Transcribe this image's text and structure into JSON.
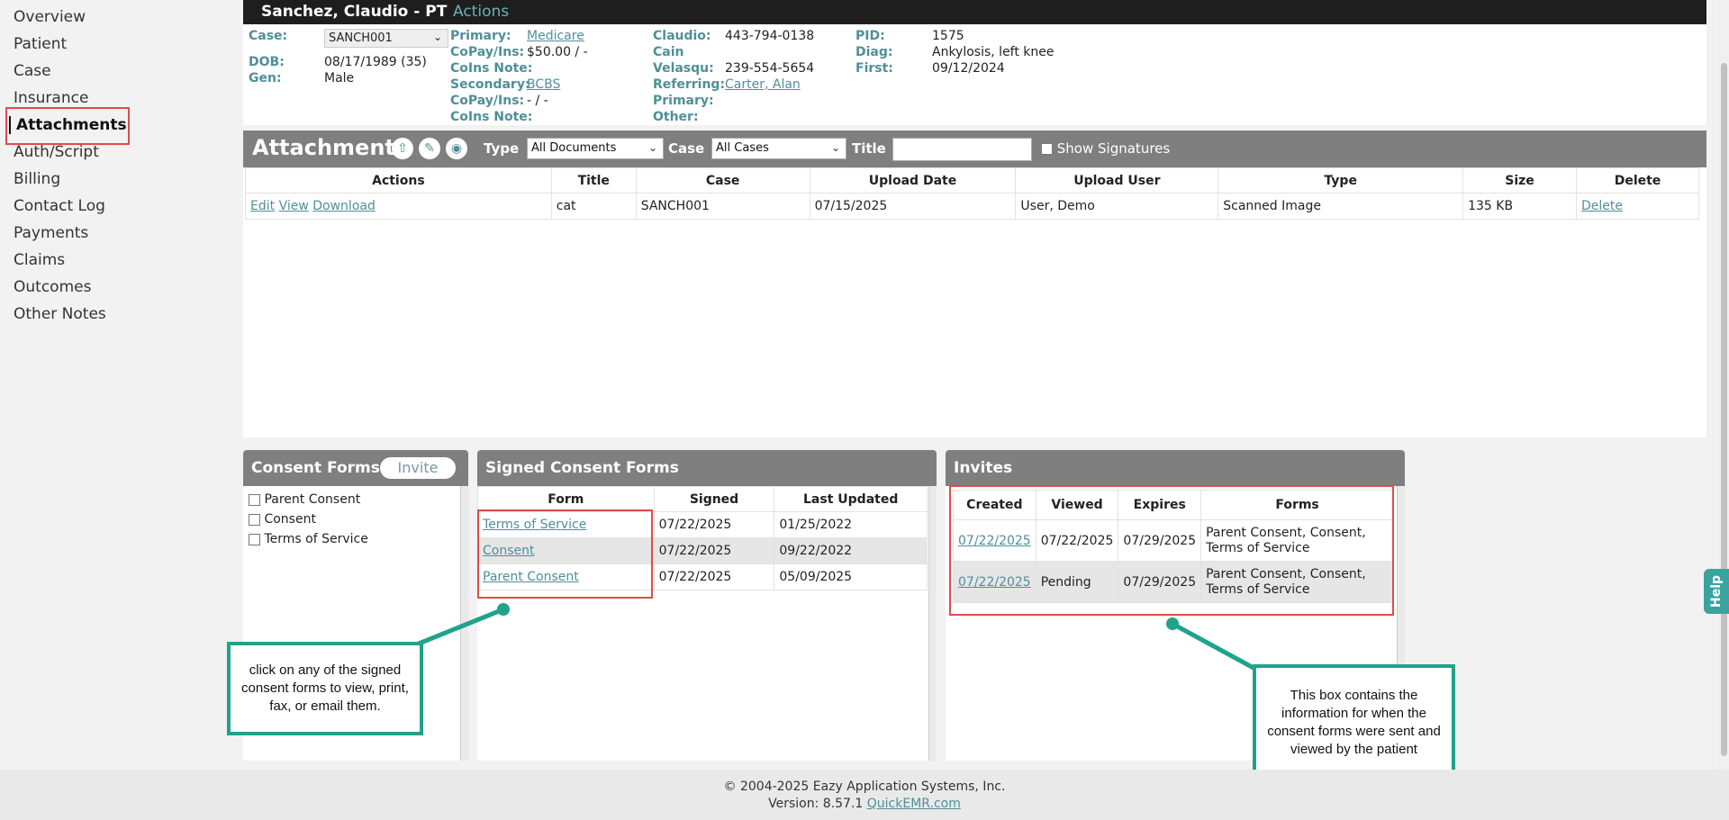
{
  "sidebar": {
    "items": [
      {
        "label": "Overview"
      },
      {
        "label": "Patient"
      },
      {
        "label": "Case"
      },
      {
        "label": "Insurance"
      },
      {
        "label": "Attachments"
      },
      {
        "label": "Auth/Script"
      },
      {
        "label": "Billing"
      },
      {
        "label": "Contact Log"
      },
      {
        "label": "Payments"
      },
      {
        "label": "Claims"
      },
      {
        "label": "Outcomes"
      },
      {
        "label": "Other Notes"
      }
    ]
  },
  "header": {
    "patient_name": "Sanchez, Claudio - PT",
    "actions_label": "Actions"
  },
  "patient_info": {
    "case_label": "Case:",
    "case_value": "SANCH001",
    "dob_label": "DOB:",
    "dob_value": "08/17/1989 (35)",
    "gen_label": "Gen:",
    "gen_value": "Male",
    "primary_label": "Primary:",
    "primary_value": "Medicare",
    "copay1_label": "CoPay/Ins:",
    "copay1_value": "$50.00 / -",
    "coins1_label": "CoIns Note:",
    "secondary_label": "Secondary:",
    "secondary_value": "BCBS",
    "copay2_label": "CoPay/Ins:",
    "copay2_value": "- / -",
    "coins2_label": "CoIns Note:",
    "claudio_label": "Claudio:",
    "claudio_value": "443-794-0138",
    "cain_label": "Cain",
    "velasqu_label": "Velasqu:",
    "velasqu_value": "239-554-5654",
    "referring_label": "Referring:",
    "referring_value": "Carter, Alan",
    "primary2_label": "Primary:",
    "other_label": "Other:",
    "pid_label": "PID:",
    "pid_value": "1575",
    "diag_label": "Diag:",
    "diag_value": "Ankylosis, left knee",
    "first_label": "First:",
    "first_value": "09/12/2024"
  },
  "attachments": {
    "title": "Attachments",
    "type_label": "Type",
    "type_value": "All Documents",
    "case_label": "Case",
    "case_value": "All Cases",
    "title_label": "Title",
    "title_input": "",
    "show_signatures_label": "Show Signatures",
    "columns": [
      "Actions",
      "Title",
      "Case",
      "Upload Date",
      "Upload User",
      "Type",
      "Size",
      "Delete"
    ],
    "rows": [
      {
        "edit": "Edit",
        "view": "View",
        "download": "Download",
        "title": "cat",
        "case": "SANCH001",
        "upload_date": "07/15/2025",
        "upload_user": "User, Demo",
        "type": "Scanned Image",
        "size": "135 KB",
        "delete": "Delete"
      }
    ]
  },
  "consent_forms": {
    "title": "Consent Forms",
    "invite_label": "Invite",
    "items": [
      {
        "label": "Parent Consent"
      },
      {
        "label": "Consent"
      },
      {
        "label": "Terms of Service"
      }
    ]
  },
  "signed_consent": {
    "title": "Signed Consent Forms",
    "columns": [
      "Form",
      "Signed",
      "Last Updated"
    ],
    "rows": [
      {
        "form": "Terms of Service",
        "signed": "07/22/2025",
        "updated": "01/25/2022"
      },
      {
        "form": "Consent",
        "signed": "07/22/2025",
        "updated": "09/22/2022"
      },
      {
        "form": "Parent Consent",
        "signed": "07/22/2025",
        "updated": "05/09/2025"
      }
    ]
  },
  "invites": {
    "title": "Invites",
    "columns": [
      "Created",
      "Viewed",
      "Expires",
      "Forms"
    ],
    "rows": [
      {
        "created": "07/22/2025",
        "viewed": "07/22/2025",
        "expires": "07/29/2025",
        "forms": "Parent Consent, Consent, Terms of Service"
      },
      {
        "created": "07/22/2025",
        "viewed": "Pending",
        "expires": "07/29/2025",
        "forms": "Parent Consent, Consent, Terms of Service"
      }
    ]
  },
  "callouts": {
    "left": "click on any of the signed consent forms to view, print, fax, or email them.",
    "right": "This box contains the information for when the consent forms were sent and viewed by the patient"
  },
  "footer": {
    "copyright": "© 2004-2025 Eazy Application Systems, Inc.",
    "version_prefix": "Version: 8.57.1",
    "site_link": "QuickEMR.com"
  },
  "help_label": "Help",
  "colors": {
    "accent": "#4f8f99",
    "header_bg": "#1e1e1e",
    "panel_head": "#7f7f7f",
    "highlight_box": "#e04b4b",
    "callout": "#1fa38a"
  }
}
